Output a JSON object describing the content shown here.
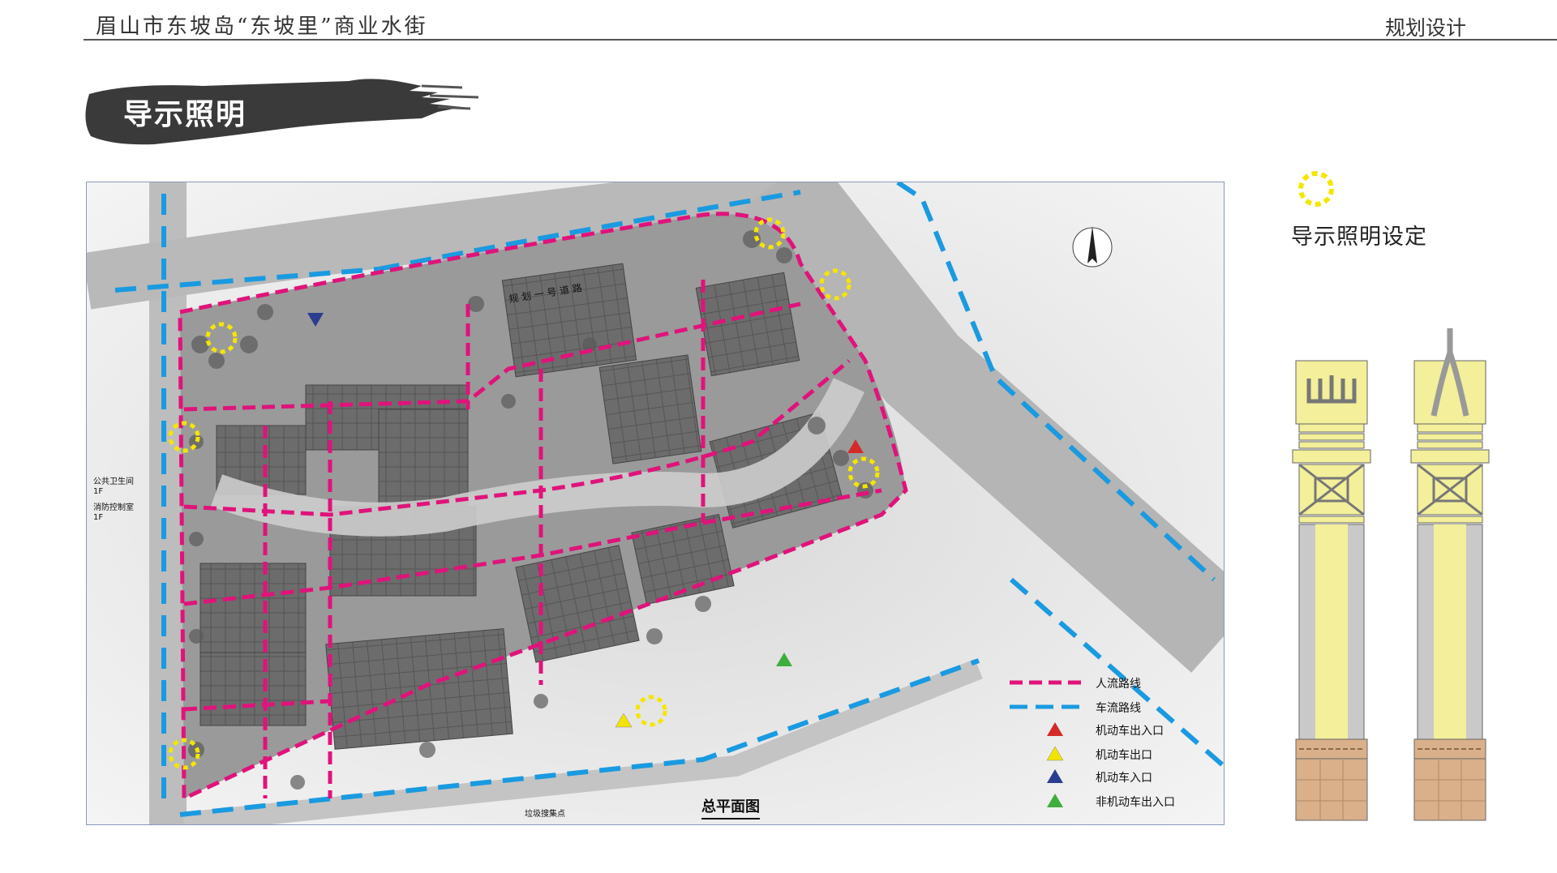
{
  "header": {
    "project_title": "眉山市东坡岛“东坡里”商业水街",
    "section": "规划设计"
  },
  "page_title": "导示照明",
  "map": {
    "caption": "总平面图",
    "road_label": "规 划 一 号 道 路",
    "side_labels": [
      "公共卫生间",
      "1F",
      "消防控制室",
      "1F"
    ],
    "bottom_label": "垃圾搜集点",
    "legend": [
      {
        "label": "人流路线",
        "type": "pedestrian-route",
        "color": "#e0137b"
      },
      {
        "label": "车流路线",
        "type": "vehicle-route",
        "color": "#1a9ae0"
      },
      {
        "label": "机动车出入口",
        "type": "triangle",
        "color": "#d42a2a"
      },
      {
        "label": "机动车出口",
        "type": "triangle",
        "color": "#f2e400"
      },
      {
        "label": "机动车入口",
        "type": "triangle",
        "color": "#2a3d8f"
      },
      {
        "label": "非机动车出入口",
        "type": "triangle",
        "color": "#3fae3f"
      }
    ]
  },
  "sidebar": {
    "lighting_label": "导示照明设定",
    "lighting_icon": "dashed-yellow-circle-icon"
  },
  "colors": {
    "pedestrian": "#e0137b",
    "vehicle": "#1a9ae0",
    "lighting": "#f5e600",
    "pillar_yellow": "#f3ef9a",
    "pillar_gray": "#c9c9c9",
    "pillar_base": "#d9b08a"
  }
}
